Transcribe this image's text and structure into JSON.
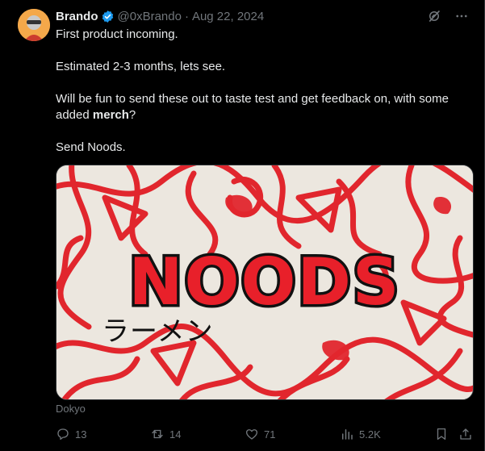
{
  "tweet": {
    "author_name": "Brando",
    "handle": "@0xBrando",
    "separator": "·",
    "date": "Aug 22, 2024",
    "lines": {
      "l1": "First product incoming.",
      "l2": "Estimated 2-3 months, lets see.",
      "l3_pre": "Will be fun to send these out to taste test and get feedback on, with some added ",
      "l3_bold": "merch",
      "l3_post": "?",
      "l4": "Send Noods."
    },
    "media": {
      "title": "NOODS",
      "subtitle": "ラーメン",
      "credit": "Dokyo"
    },
    "stats": {
      "replies": "13",
      "reposts": "14",
      "likes": "71",
      "views": "5.2K"
    }
  },
  "colors": {
    "background": "#000000",
    "text": "#e7e9ea",
    "muted": "#71767b",
    "verified": "#1d9bf0",
    "noods_red": "#e8202a",
    "avatar": "#f4a84a"
  },
  "icons": {
    "verified": "verified-badge-icon",
    "grok": "grok-icon",
    "more": "more-icon",
    "reply": "reply-icon",
    "repost": "repost-icon",
    "like": "heart-icon",
    "views": "views-icon",
    "bookmark": "bookmark-icon",
    "share": "share-icon"
  }
}
